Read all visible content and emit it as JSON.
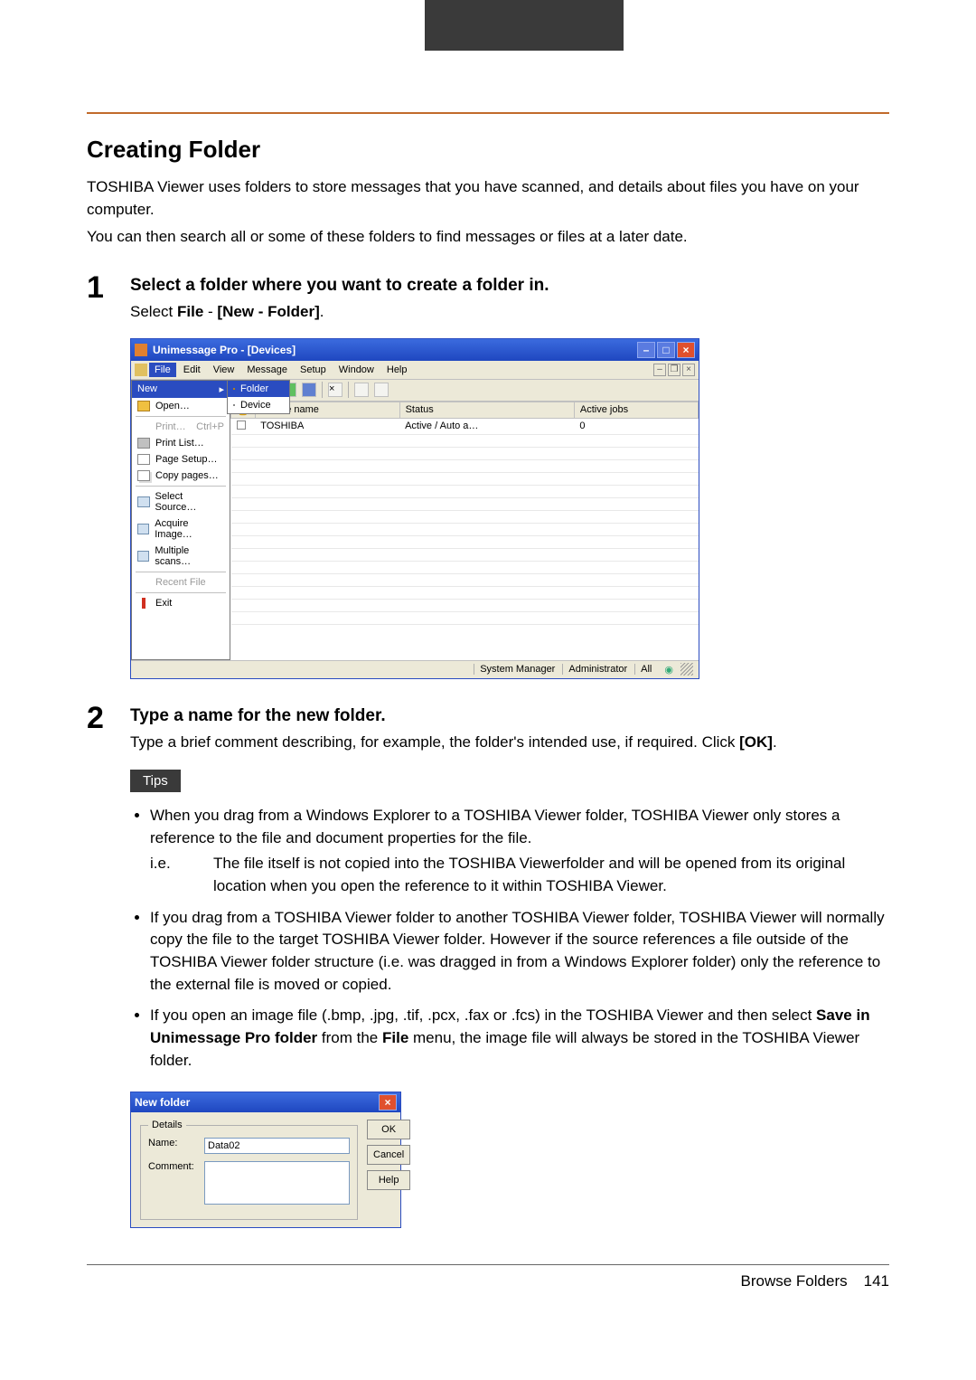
{
  "page": {
    "section_title": "Creating Folder",
    "intro1": "TOSHIBA Viewer uses folders to store messages that you have scanned, and details about files you have on your computer.",
    "intro2": "You can then search all or some of these folders to find messages or files at a later date."
  },
  "step1": {
    "num": "1",
    "title": "Select a folder where you want to create a folder in.",
    "line_prefix": "Select ",
    "line_file": "File",
    "line_dash": " - ",
    "line_bracket_open": "[",
    "line_new": "New - Folder",
    "line_bracket_close": "]",
    "line_period": "."
  },
  "main_window": {
    "title": "Unimessage Pro - [Devices]",
    "menu": {
      "file": "File",
      "edit": "Edit",
      "view": "View",
      "message": "Message",
      "setup": "Setup",
      "window": "Window",
      "help": "Help"
    },
    "file_menu": {
      "new": "New",
      "open": "Open…",
      "print": "Print…",
      "print_shortcut": "Ctrl+P",
      "print_list": "Print List…",
      "page_setup": "Page Setup…",
      "copy_pages": "Copy pages…",
      "select_source": "Select Source…",
      "acquire_image": "Acquire Image…",
      "multiple_scans": "Multiple scans…",
      "recent_file": "Recent File",
      "exit": "Exit"
    },
    "new_submenu": {
      "folder": "Folder",
      "device": "Device"
    },
    "columns": {
      "c0": "",
      "c1": "Device name",
      "c2": "Status",
      "c3": "Active jobs"
    },
    "row": {
      "name": "TOSHIBA",
      "status": "Active / Auto a…",
      "jobs": "0"
    },
    "statusbar": {
      "a": "System Manager",
      "b": "Administrator",
      "c": "All"
    }
  },
  "step2": {
    "num": "2",
    "title": "Type a name for the new folder.",
    "line1": "Type a brief comment describing, for example, the folder's intended use, if required. Click ",
    "ok": "[OK]",
    "period": "."
  },
  "tips": {
    "label": "Tips",
    "t1a": "When you drag from a Windows Explorer to a TOSHIBA Viewer folder, TOSHIBA Viewer only stores a reference to the file and document properties for the file.",
    "ie_label": "i.e.",
    "ie_body": "The file itself is not copied into the TOSHIBA Viewerfolder and will be opened from its original location when you open the reference to it within TOSHIBA Viewer.",
    "t2": "If you drag from a TOSHIBA Viewer folder to another TOSHIBA Viewer folder, TOSHIBA Viewer will normally copy the file to the target TOSHIBA Viewer folder. However if the source references a file outside of the TOSHIBA Viewer folder structure (i.e. was dragged in from a Windows Explorer folder) only the reference to the external file is moved or copied.",
    "t3a": "If you open an image file (.bmp, .jpg, .tif, .pcx, .fax or .fcs) in the TOSHIBA Viewer and then select ",
    "t3b": "Save in Unimessage Pro folder",
    "t3c": " from the ",
    "t3d": "File",
    "t3e": " menu, the image file will always be stored in the TOSHIBA Viewer folder."
  },
  "dialog": {
    "title": "New folder",
    "legend": "Details",
    "name_label": "Name:",
    "name_value": "Data02",
    "comment_label": "Comment:",
    "comment_value": "",
    "ok": "OK",
    "cancel": "Cancel",
    "help": "Help"
  },
  "footer": {
    "label": "Browse Folders",
    "page": "141"
  }
}
